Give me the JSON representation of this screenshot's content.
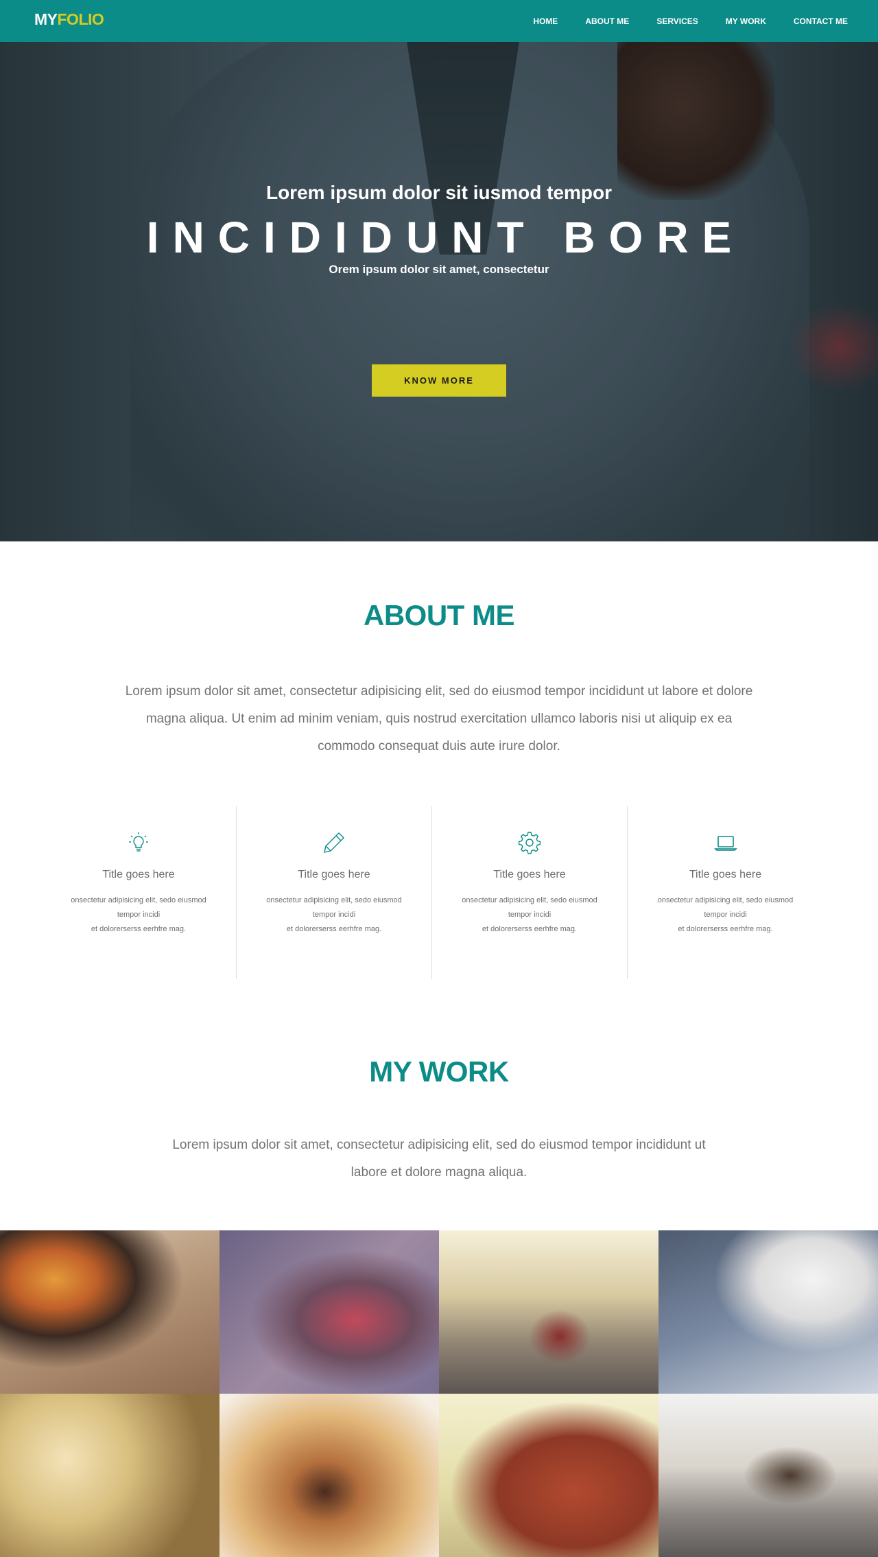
{
  "nav": {
    "logo_my": "MY",
    "logo_folio": "FOLIO",
    "items": [
      "HOME",
      "ABOUT ME",
      "SERVICES",
      "MY WORK",
      "CONTACT ME"
    ]
  },
  "hero": {
    "subtitle": "Lorem ipsum dolor sit iusmod tempor",
    "title": "INCIDIDUNT BORE",
    "tagline": "Orem ipsum dolor sit amet, consectetur",
    "button": "KNOW MORE"
  },
  "about": {
    "title": "ABOUT ME",
    "text": "Lorem ipsum dolor sit amet, consectetur adipisicing elit, sed do eiusmod tempor incididunt ut labore et dolore magna aliqua. Ut enim ad minim veniam, quis nostrud exercitation ullamco laboris nisi ut aliquip ex ea commodo consequat duis aute irure dolor.",
    "features": [
      {
        "icon": "lightbulb-icon",
        "title": "Title goes here",
        "desc_line1": "onsectetur adipisicing elit, sedo eiusmod",
        "desc_line2": "tempor incidi",
        "desc_line3": "et dolorerserss eerhfre mag."
      },
      {
        "icon": "pencil-icon",
        "title": "Title goes here",
        "desc_line1": "onsectetur adipisicing elit, sedo eiusmod",
        "desc_line2": "tempor incidi",
        "desc_line3": "et dolorerserss eerhfre mag."
      },
      {
        "icon": "gear-icon",
        "title": "Title goes here",
        "desc_line1": "onsectetur adipisicing elit, sedo eiusmod",
        "desc_line2": "tempor incidi",
        "desc_line3": "et dolorerserss eerhfre mag."
      },
      {
        "icon": "laptop-icon",
        "title": "Title goes here",
        "desc_line1": "onsectetur adipisicing elit, sedo eiusmod",
        "desc_line2": "tempor incidi",
        "desc_line3": "et dolorerserss eerhfre mag."
      }
    ]
  },
  "work": {
    "title": "MY WORK",
    "text": "Lorem ipsum dolor sit amet, consectetur adipisicing elit, sed do eiusmod tempor incididunt ut labore et dolore magna aliqua."
  },
  "colors": {
    "brand_teal": "#0c8c88",
    "accent_yellow": "#d6cd22",
    "body_text": "#737373"
  }
}
